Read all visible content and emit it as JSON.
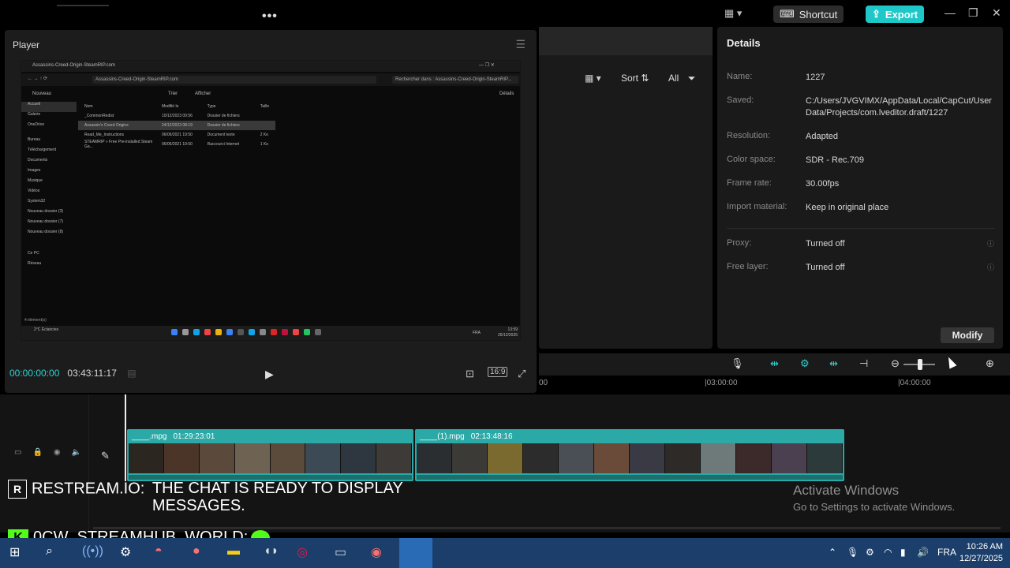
{
  "titlebar": {
    "shortcut_label": "Shortcut",
    "export_label": "Export"
  },
  "player": {
    "title": "Player",
    "current_time": "00:00:00:00",
    "total_time": "03:43:11:17",
    "ratio_label": "16:9"
  },
  "preview": {
    "tab_title": "Assassins-Creed-Origin-SteamRIP.com",
    "address": "Assassins-Creed-Origin-SteamRIP.com",
    "search": "Rechercher dans : Assassins-Creed-Origin-SteamRIP...",
    "toolbar": [
      "Nouveau",
      "Trier",
      "Afficher",
      "Détails"
    ],
    "sidebar": [
      "Accueil",
      "Galerie",
      "OneDrive",
      "Bureau",
      "Téléchargement",
      "Documents",
      "Images",
      "Musique",
      "Vidéos",
      "System32",
      "Nouveau dossier (3)",
      "Nouveau dossier (7)",
      "Nouveau dossier (8)",
      "Ce PC",
      "Réseau"
    ],
    "columns": [
      "Nom",
      "Modifié le",
      "Type",
      "Taille"
    ],
    "files": [
      {
        "name": "_CommonRedist",
        "date": "10/12/2023 00:56",
        "type": "Dossier de fichiers",
        "size": ""
      },
      {
        "name": "Assassin's Creed Origins",
        "date": "24/12/2023 08:19",
        "type": "Dossier de fichiers",
        "size": ""
      },
      {
        "name": "Read_Me_Instructions",
        "date": "06/06/2021 19:50",
        "type": "Document texte",
        "size": "2 Ko"
      },
      {
        "name": "STEAMRIP » Free Pre-installed Steam Ga...",
        "date": "06/06/2021 19:50",
        "type": "Raccourci Internet",
        "size": "1 Ko"
      }
    ],
    "status": "4 élément(s)",
    "weather": "2°C Éclaircies",
    "lang": "FRA",
    "time": "13:59",
    "date": "26/12/2025"
  },
  "media": {
    "sort_label": "Sort",
    "all_label": "All"
  },
  "details": {
    "title": "Details",
    "rows": [
      {
        "label": "Name:",
        "value": "1227"
      },
      {
        "label": "Saved:",
        "value": "C:/Users/JVGVIMX/AppData/Local/CapCut/User Data/Projects/com.lveditor.draft/1227"
      },
      {
        "label": "Resolution:",
        "value": "Adapted"
      },
      {
        "label": "Color space:",
        "value": "SDR - Rec.709"
      },
      {
        "label": "Frame rate:",
        "value": "30.00fps"
      },
      {
        "label": "Import material:",
        "value": "Keep in original place"
      },
      {
        "label": "Proxy:",
        "value": "Turned off"
      },
      {
        "label": "Free layer:",
        "value": "Turned off"
      }
    ],
    "modify_label": "Modify"
  },
  "timeline": {
    "ruler": [
      "00",
      "|03:00:00",
      "|04:00:00"
    ],
    "clips": [
      {
        "name": "____.mpg",
        "duration": "01:29:23:01"
      },
      {
        "name": "____(1).mpg",
        "duration": "02:13:48:16"
      }
    ]
  },
  "overlay": {
    "chat_user1": "RESTREAM.IO:",
    "chat_msg1": "THE CHAT IS READY TO DISPLAY MESSAGES.",
    "chat_user2": "0CW_STREAMHUB_WORLD:",
    "activate_title": "Activate Windows",
    "activate_sub": "Go to Settings to activate Windows."
  },
  "taskbar": {
    "lang": "FRA",
    "time": "10:26 AM",
    "date": "12/27/2025"
  },
  "colors": {
    "accent": "#1fc8c8",
    "clip": "#2aa9a7",
    "taskbar": "#1b3e6a"
  }
}
